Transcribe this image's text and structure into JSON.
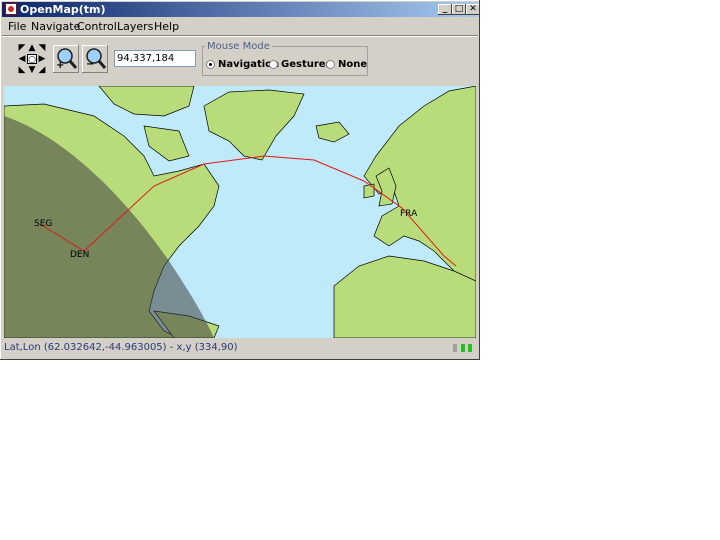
{
  "window": {
    "title": "OpenMap(tm)",
    "controls": {
      "minimize": "_",
      "maximize": "□",
      "close": "✕"
    }
  },
  "menu": {
    "items": [
      {
        "label": "File"
      },
      {
        "label": "Navigate"
      },
      {
        "label": "Control"
      },
      {
        "label": "Layers"
      },
      {
        "label": "Help"
      }
    ]
  },
  "toolbar": {
    "navpad_icons": [
      "arrow-up-icon",
      "arrow-down-icon",
      "arrow-left-icon",
      "arrow-right-icon",
      "recenter-icon"
    ],
    "zoom_in_label": "+",
    "zoom_out_label": "−",
    "scale_value": "94,337,184"
  },
  "mouse_mode": {
    "legend": "Mouse Mode",
    "options": [
      {
        "label": "Navigation",
        "selected": true
      },
      {
        "label": "Gestures",
        "selected": false
      },
      {
        "label": "None",
        "selected": false
      }
    ]
  },
  "map": {
    "cities": [
      {
        "label": "SEG"
      },
      {
        "label": "DEN"
      },
      {
        "label": "FRA"
      }
    ],
    "colors": {
      "ocean": "#bfeafa",
      "land": "#b9dc7a",
      "night": "#404040",
      "route": "#e01818"
    }
  },
  "statusbar": {
    "text": "Lat,Lon (62.032642,-44.963005) - x,y (334,90)",
    "indicator_color": "#22c022"
  }
}
